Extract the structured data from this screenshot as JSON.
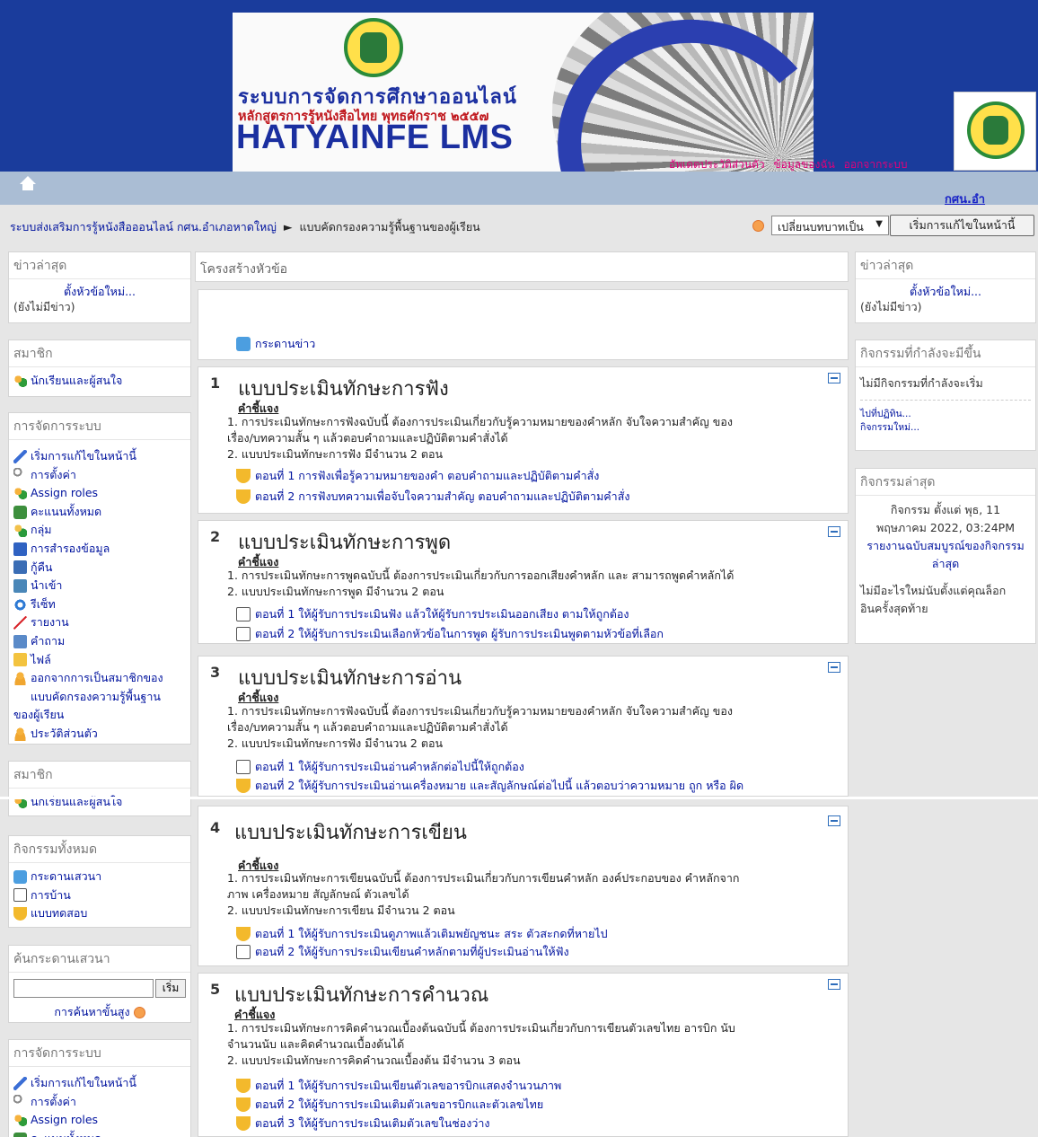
{
  "header": {
    "banner_line1": "ระบบการจัดการศึกษาออนไลน์",
    "banner_line2": "หลักสูตรการรู้หนังสือไทย พุทธศักราช ๒๕๕๗",
    "banner_line3": "HATYAINFE LMS",
    "user_links": [
      "อัพเดตประวัติส่วนตัว",
      "ข้อมูลของฉัน",
      "ออกจากระบบ"
    ],
    "org_link": "กศน.อำ"
  },
  "breadcrumb": {
    "home": "ระบบส่งเสริมการรู้หนังสือออนไลน์ กศน.อำเภอหาดใหญ่",
    "separator": "►",
    "current": "แบบคัดกรองความรู้พื้นฐานของผู้เรียน"
  },
  "toolbar": {
    "role_select": "เปลี่ยนบทบาทเป็น",
    "edit_button": "เริ่มการแก้ไขในหน้านี้"
  },
  "left": {
    "news": {
      "title": "ข่าวล่าสุด",
      "add": "ตั้งหัวข้อใหม่...",
      "empty": "(ยังไม่มีข่าว)"
    },
    "members": {
      "title": "สมาชิก",
      "item": "นักเรียนและผู้สนใจ"
    },
    "admin": {
      "title": "การจัดการระบบ",
      "items": [
        {
          "label": "เริ่มการแก้ไขในหน้านี้",
          "icon": "pencil-icon"
        },
        {
          "label": "การตั้งค่า",
          "icon": "wrench-icon"
        },
        {
          "label": "Assign roles",
          "icon": "assign-roles-icon"
        },
        {
          "label": "คะแนนทั้งหมด",
          "icon": "grades-icon"
        },
        {
          "label": "กลุ่ม",
          "icon": "groups-icon"
        },
        {
          "label": "การสำรองข้อมูล",
          "icon": "backup-icon"
        },
        {
          "label": "กู้คืน",
          "icon": "restore-icon"
        },
        {
          "label": "นำเข้า",
          "icon": "import-icon"
        },
        {
          "label": "รีเซ็ท",
          "icon": "reset-icon"
        },
        {
          "label": "รายงาน",
          "icon": "reports-icon"
        },
        {
          "label": "คำถาม",
          "icon": "questions-icon"
        },
        {
          "label": "ไฟล์",
          "icon": "files-icon"
        }
      ],
      "unenrol_line1": "ออกจากการเป็นสมาชิกของ",
      "unenrol_line2": "แบบคัดกรองความรู้พื้นฐาน",
      "unenrol_line3": "ของผู้เรียน",
      "profile": "ประวัติส่วนตัว"
    },
    "members2": {
      "title": "สมาชิก",
      "item": "นักเรียนและผู้สนใจ"
    },
    "activities": {
      "title": "กิจกรรมทั้งหมด",
      "items": [
        {
          "label": "กระดานเสวนา",
          "icon": "forum-icon"
        },
        {
          "label": "การบ้าน",
          "icon": "assignment-icon"
        },
        {
          "label": "แบบทดสอบ",
          "icon": "quiz-icon"
        }
      ]
    },
    "search": {
      "title": "ค้นกระดานเสวนา",
      "value": "",
      "go": "เริ่ม",
      "advanced": "การค้นหาขั้นสูง"
    },
    "admin2": {
      "title": "การจัดการระบบ",
      "items": [
        {
          "label": "เริ่มการแก้ไขในหน้านี้"
        },
        {
          "label": "การตั้งค่า"
        },
        {
          "label": "Assign roles"
        },
        {
          "label": "คะแนนทั้งหมด"
        }
      ]
    }
  },
  "main": {
    "heading": "โครงสร้างหัวข้อ",
    "news_forum": "กระดานข่าว",
    "sections": [
      {
        "num": "1",
        "title": "แบบประเมินทักษะการฟัง",
        "label": "คำชี้แจง",
        "desc": [
          "1. การประเมินทักษะการฟังฉบับนี้ ต้องการประเมินเกี่ยวกับรู้ความหมายของคำหลัก จับใจความสำคัญ ของ",
          "เรื่อง/บทความสั้น ๆ แล้วตอบคำถามและปฏิบัติตามคำสั่งได้",
          "2. แบบประเมินทักษะการฟัง มีจำนวน 2 ตอน"
        ],
        "activities": [
          {
            "type": "quiz",
            "label": "ตอนที่ 1 การฟังเพื่อรู้ความหมายของคำ ตอบคำถามและปฏิบัติตามคำสั่ง"
          },
          {
            "type": "quiz",
            "label": "ตอนที่ 2 การฟังบทความเพื่อจับใจความสำคัญ ตอบคำถามและปฏิบัติตามคำสั่ง"
          }
        ]
      },
      {
        "num": "2",
        "title": "แบบประเมินทักษะการพูด",
        "label": "คำชี้แจง",
        "desc": [
          "1. การประเมินทักษะการพูดฉบับนี้ ต้องการประเมินเกี่ยวกับการออกเสียงคำหลัก และ สามารถพูดคำหลักได้",
          "2. แบบประเมินทักษะการพูด มีจำนวน 2 ตอน"
        ],
        "activities": [
          {
            "type": "assignment",
            "label": "ตอนที่ 1 ให้ผู้รับการประเมินฟัง แล้วให้ผู้รับการประเมินออกเสียง ตามให้ถูกต้อง"
          },
          {
            "type": "assignment",
            "label": "ตอนที่ 2 ให้ผู้รับการประเมินเลือกหัวข้อในการพูด ผู้รับการประเมินพูดตามหัวข้อที่เลือก"
          }
        ]
      },
      {
        "num": "3",
        "title": "แบบประเมินทักษะการอ่าน",
        "label": "คำชี้แจง",
        "desc": [
          "1. การประเมินทักษะการฟังฉบับนี้ ต้องการประเมินเกี่ยวกับรู้ความหมายของคำหลัก จับใจความสำคัญ ของ",
          "เรื่อง/บทความสั้น ๆ แล้วตอบคำถามและปฏิบัติตามคำสั่งได้",
          "2. แบบประเมินทักษะการฟัง มีจำนวน 2 ตอน"
        ],
        "activities": [
          {
            "type": "assignment",
            "label": "ตอนที่ 1 ให้ผู้รับการประเมินอ่านคำหลักต่อไปนี้ให้ถูกต้อง"
          },
          {
            "type": "quiz",
            "label": "ตอนที่ 2 ให้ผู้รับการประเมินอ่านเครื่องหมาย และสัญลักษณ์ต่อไปนี้ แล้วตอบว่าความหมาย ถูก หรือ ผิด"
          }
        ]
      },
      {
        "num": "4",
        "title": "แบบประเมินทักษะการเขียน",
        "label": "คำชี้แจง",
        "desc": [
          "1. การประเมินทักษะการเขียนฉบับนี้ ต้องการประเมินเกี่ยวกับการเขียนคำหลัก องค์ประกอบของ คำหลักจาก",
          "ภาพ เครื่องหมาย สัญลักษณ์ ตัวเลขได้",
          "2. แบบประเมินทักษะการเขียน มีจำนวน 2 ตอน"
        ],
        "activities": [
          {
            "type": "quiz",
            "label": "ตอนที่ 1 ให้ผู้รับการประเมินดูภาพแล้วเติมพยัญชนะ สระ ตัวสะกดที่หายไป"
          },
          {
            "type": "assignment",
            "label": "ตอนที่ 2 ให้ผู้รับการประเมินเขียนคำหลักตามที่ผู้ประเมินอ่านให้ฟัง"
          }
        ]
      },
      {
        "num": "5",
        "title": "แบบประเมินทักษะการคำนวณ",
        "label": "คำชี้แจง",
        "desc": [
          "1. การประเมินทักษะการคิดคำนวณเบื้องต้นฉบับนี้ ต้องการประเมินเกี่ยวกับการเขียนตัวเลขไทย อารบิก นับ",
          "จำนวนนับ และคิดคำนวณเบื้องต้นได้",
          "2. แบบประเมินทักษะการคิดคำนวณเบื้องต้น มีจำนวน 3 ตอน"
        ],
        "activities": [
          {
            "type": "quiz",
            "label": "ตอนที่ 1 ให้ผู้รับการประเมินเขียนตัวเลขอารบิกแสดงจำนวนภาพ"
          },
          {
            "type": "quiz",
            "label": "ตอนที่ 2 ให้ผู้รับการประเมินเติมตัวเลขอารบิกและตัวเลขไทย"
          },
          {
            "type": "quiz",
            "label": "ตอนที่ 3 ให้ผู้รับการประเมินเติมตัวเลขในช่องว่าง"
          }
        ]
      }
    ]
  },
  "right": {
    "news": {
      "title": "ข่าวล่าสุด",
      "add": "ตั้งหัวข้อใหม่...",
      "empty": "(ยังไม่มีข่าว)"
    },
    "upcoming": {
      "title": "กิจกรรมที่กำลังจะมีขึ้น",
      "empty": "ไม่มีกิจกรรมที่กำลังจะเริ่ม",
      "calendar": "ไปที่ปฏิทิน...",
      "new_event": "กิจกรรมใหม่..."
    },
    "recent": {
      "title": "กิจกรรมล่าสุด",
      "since_line1": "กิจกรรม ตั้งแต่ พุธ, 11",
      "since_line2": "พฤษภาคม 2022, 03:24PM",
      "full_report": "รายงานฉบับสมบูรณ์ของกิจกรรม",
      "full_report2": "ล่าสุด",
      "nothing1": "ไม่มีอะไรใหม่นับตั้งแต่คุณล็อก",
      "nothing2": "อินครั้งสุดท้าย"
    }
  }
}
